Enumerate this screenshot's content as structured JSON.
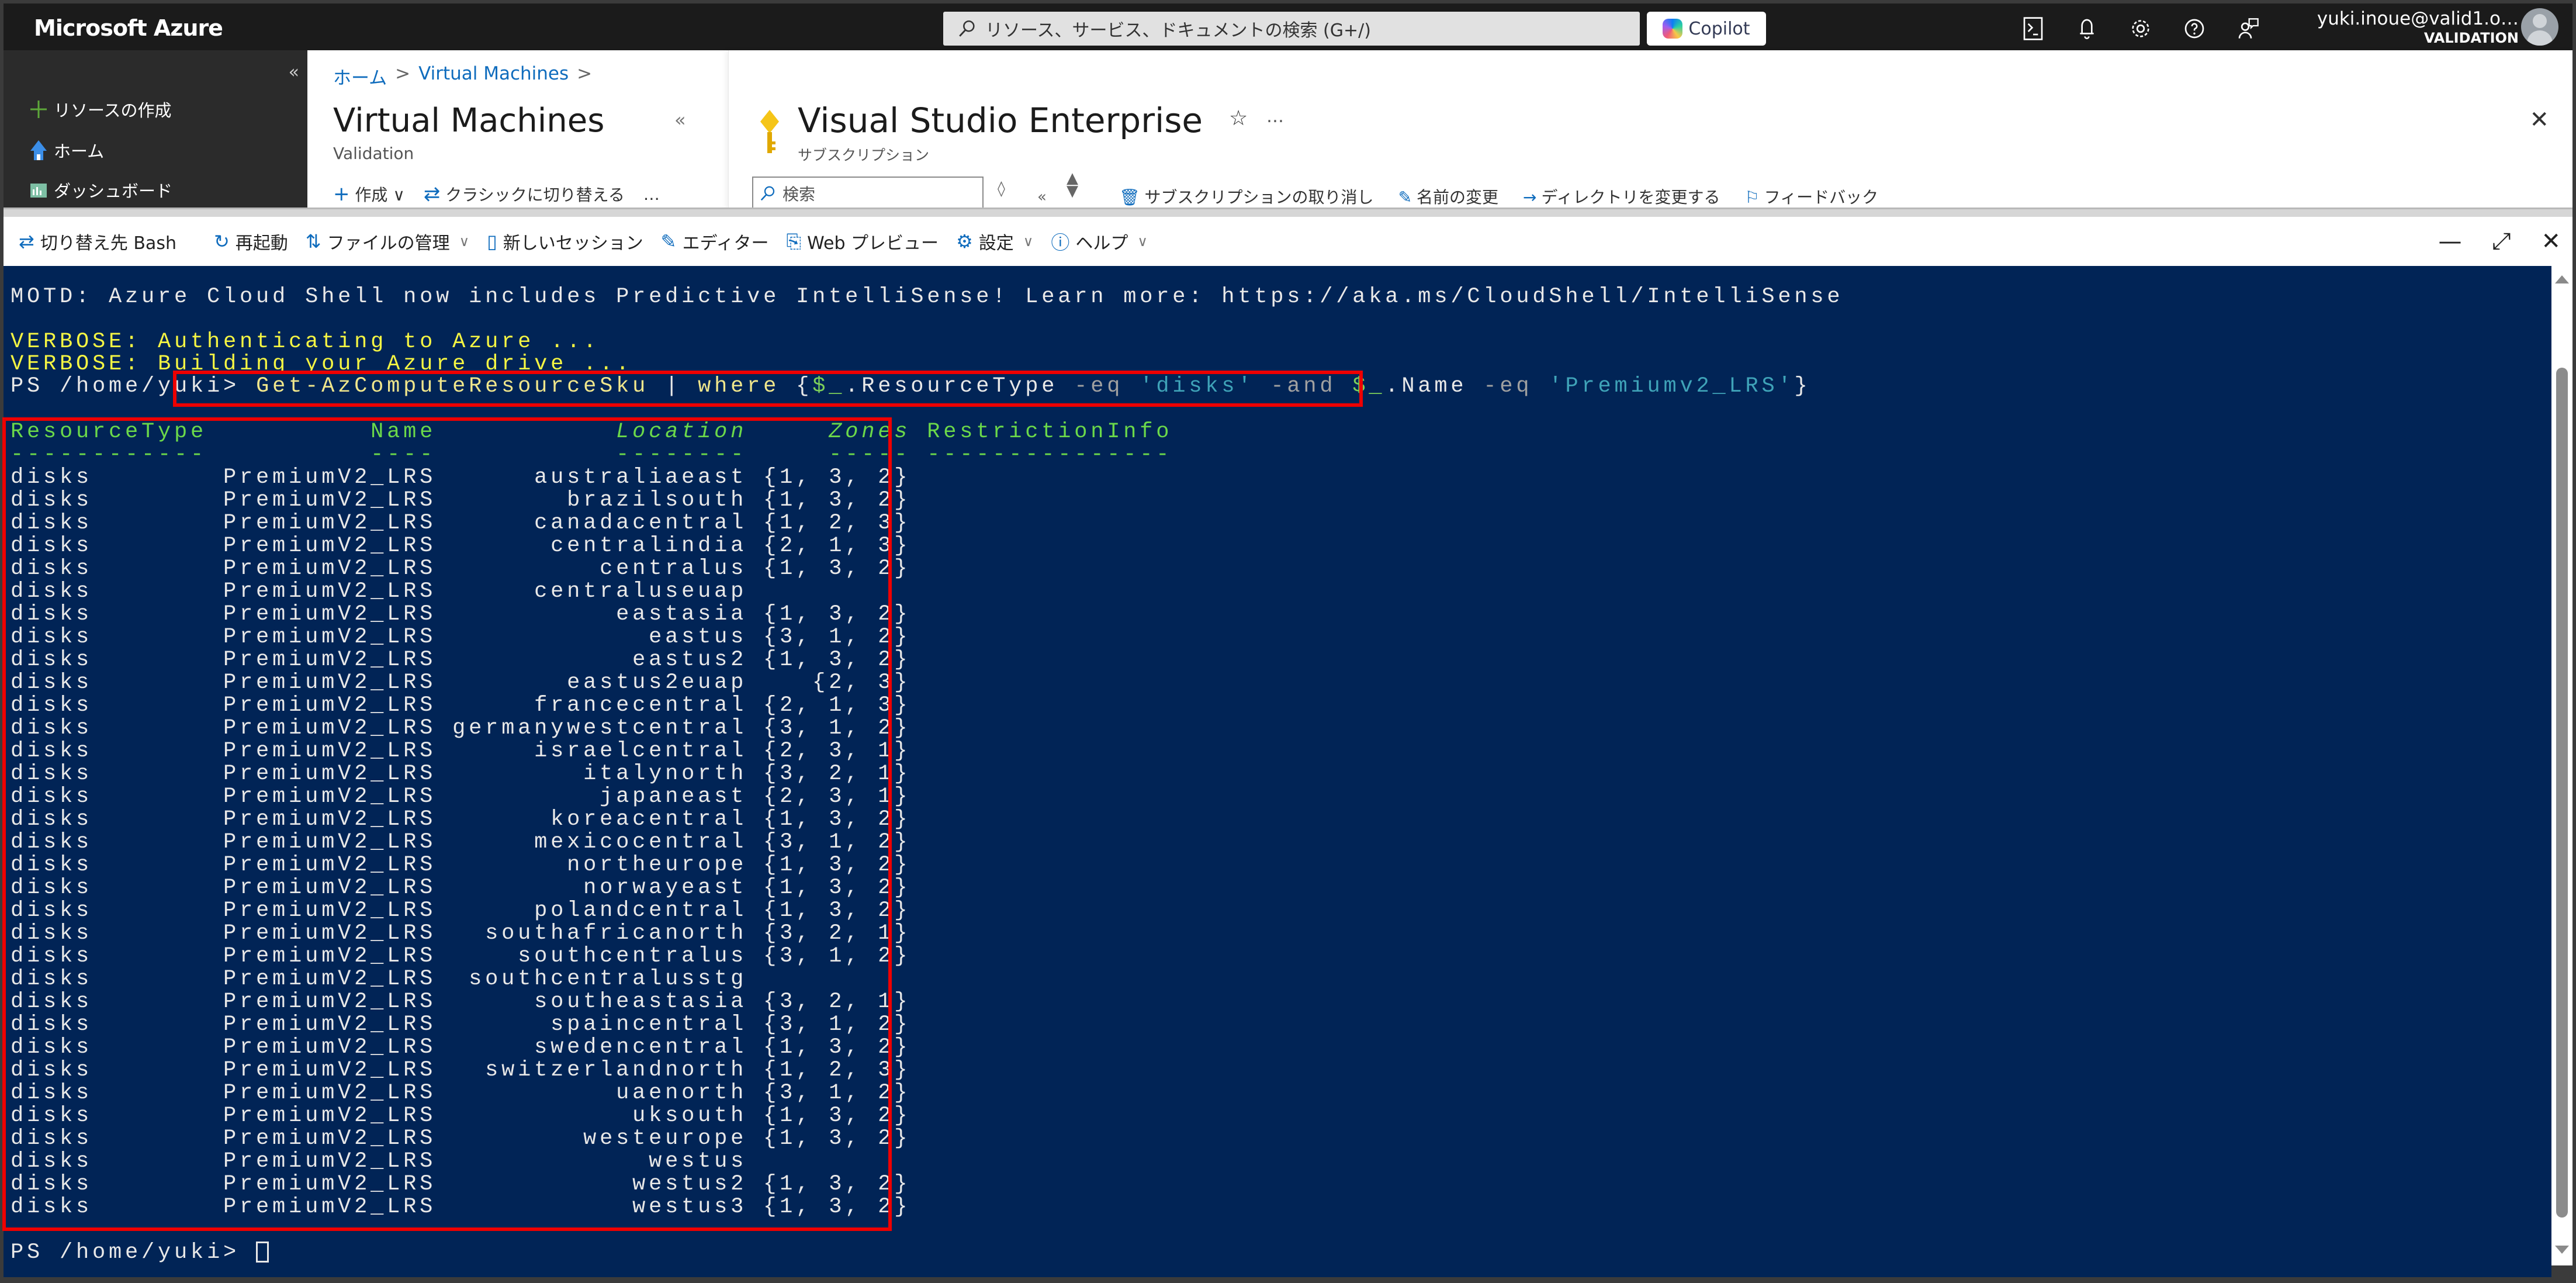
{
  "topbar": {
    "brand": "Microsoft Azure",
    "search_placeholder": "リソース、サービス、ドキュメントの検索 (G+/)",
    "copilot_label": "Copilot",
    "icons": [
      "cloud-shell-icon",
      "notifications-icon",
      "settings-icon",
      "help-icon",
      "feedback-icon"
    ],
    "account_email": "yuki.inoue@valid1.o…",
    "account_tenant": "VALIDATION"
  },
  "sidebar": {
    "collapse": "«",
    "items": [
      {
        "label": "リソースの作成",
        "icon": "plus-icon"
      },
      {
        "label": "ホーム",
        "icon": "home-icon"
      },
      {
        "label": "ダッシュボード",
        "icon": "dashboard-icon"
      }
    ]
  },
  "breadcrumb": [
    {
      "label": "ホーム"
    },
    {
      "label": "Virtual Machines"
    }
  ],
  "breadcrumb_sep": ">",
  "vm_blade": {
    "title": "Virtual Machines",
    "subtitle": "Validation",
    "collapse": "«",
    "commands": [
      {
        "label": "作成",
        "icon": "plus-icon",
        "dropdown": true
      },
      {
        "label": "クラシックに切り替える",
        "icon": "switch-icon"
      }
    ],
    "more": "…"
  },
  "sub_blade": {
    "title": "Visual Studio Enterprise",
    "subtitle": "サブスクリプション",
    "star": "☆",
    "more": "…",
    "close": "✕",
    "search_placeholder": "検索",
    "commands": [
      {
        "label": "サブスクリプションの取り消し",
        "icon": "delete-icon"
      },
      {
        "label": "名前の変更",
        "icon": "edit-icon"
      },
      {
        "label": "ディレクトリを変更する",
        "icon": "arrow-right-icon"
      },
      {
        "label": "フィードバック",
        "icon": "feedback-icon"
      }
    ]
  },
  "shell_toolbar": {
    "items": [
      {
        "label": "切り替え先 Bash",
        "icon": "switch-icon",
        "dropdown": false
      },
      {
        "label": "再起動",
        "icon": "restart-icon",
        "dropdown": false
      },
      {
        "label": "ファイルの管理",
        "icon": "upload-download-icon",
        "dropdown": true
      },
      {
        "label": "新しいセッション",
        "icon": "new-session-icon",
        "dropdown": false
      },
      {
        "label": "エディター",
        "icon": "editor-icon",
        "dropdown": false
      },
      {
        "label": "Web プレビュー",
        "icon": "web-preview-icon",
        "dropdown": false
      },
      {
        "label": "設定",
        "icon": "settings-icon",
        "dropdown": true
      },
      {
        "label": "ヘルプ",
        "icon": "help-icon",
        "dropdown": true
      }
    ],
    "window_controls": {
      "minimize": "—",
      "maximize": "⤢",
      "close": "✕"
    }
  },
  "terminal": {
    "motd": "MOTD: Azure Cloud Shell now includes Predictive IntelliSense! Learn more: https://aka.ms/CloudShell/IntelliSense",
    "verbose": [
      "VERBOSE: Authenticating to Azure ...",
      "VERBOSE: Building your Azure drive ..."
    ],
    "prompt": "PS /home/yuki> ",
    "command": {
      "cmdlet": "Get-AzComputeResourceSku",
      "pipe": " | ",
      "where": "where",
      "open": " {",
      "var1": "$_",
      "prop1": ".ResourceType ",
      "op1": "-eq ",
      "str1": "'disks'",
      "and": " -and ",
      "var2": "$_",
      "prop2": ".Name ",
      "op2": "-eq ",
      "str2": "'Premiumv2_LRS'",
      "close": "}"
    },
    "table": {
      "columns": [
        "ResourceType",
        "Name",
        "Location",
        "Zones",
        "RestrictionInfo"
      ],
      "header_line": "ResourceType          Name           Location     Zones RestrictionInfo",
      "underline": "------------          ----           --------     ----- ---------------",
      "rows": [
        {
          "ResourceType": "disks",
          "Name": "PremiumV2_LRS",
          "Location": "australiaeast",
          "Zones": "{1, 3, 2}"
        },
        {
          "ResourceType": "disks",
          "Name": "PremiumV2_LRS",
          "Location": "brazilsouth",
          "Zones": "{1, 3, 2}"
        },
        {
          "ResourceType": "disks",
          "Name": "PremiumV2_LRS",
          "Location": "canadacentral",
          "Zones": "{1, 2, 3}"
        },
        {
          "ResourceType": "disks",
          "Name": "PremiumV2_LRS",
          "Location": "centralindia",
          "Zones": "{2, 1, 3}"
        },
        {
          "ResourceType": "disks",
          "Name": "PremiumV2_LRS",
          "Location": "centralus",
          "Zones": "{1, 3, 2}"
        },
        {
          "ResourceType": "disks",
          "Name": "PremiumV2_LRS",
          "Location": "centraluseuap",
          "Zones": ""
        },
        {
          "ResourceType": "disks",
          "Name": "PremiumV2_LRS",
          "Location": "eastasia",
          "Zones": "{1, 3, 2}"
        },
        {
          "ResourceType": "disks",
          "Name": "PremiumV2_LRS",
          "Location": "eastus",
          "Zones": "{3, 1, 2}"
        },
        {
          "ResourceType": "disks",
          "Name": "PremiumV2_LRS",
          "Location": "eastus2",
          "Zones": "{1, 3, 2}"
        },
        {
          "ResourceType": "disks",
          "Name": "PremiumV2_LRS",
          "Location": "eastus2euap",
          "Zones": "{2, 3}"
        },
        {
          "ResourceType": "disks",
          "Name": "PremiumV2_LRS",
          "Location": "francecentral",
          "Zones": "{2, 1, 3}"
        },
        {
          "ResourceType": "disks",
          "Name": "PremiumV2_LRS",
          "Location": "germanywestcentral",
          "Zones": "{3, 1, 2}"
        },
        {
          "ResourceType": "disks",
          "Name": "PremiumV2_LRS",
          "Location": "israelcentral",
          "Zones": "{2, 3, 1}"
        },
        {
          "ResourceType": "disks",
          "Name": "PremiumV2_LRS",
          "Location": "italynorth",
          "Zones": "{3, 2, 1}"
        },
        {
          "ResourceType": "disks",
          "Name": "PremiumV2_LRS",
          "Location": "japaneast",
          "Zones": "{2, 3, 1}"
        },
        {
          "ResourceType": "disks",
          "Name": "PremiumV2_LRS",
          "Location": "koreacentral",
          "Zones": "{1, 3, 2}"
        },
        {
          "ResourceType": "disks",
          "Name": "PremiumV2_LRS",
          "Location": "mexicocentral",
          "Zones": "{3, 1, 2}"
        },
        {
          "ResourceType": "disks",
          "Name": "PremiumV2_LRS",
          "Location": "northeurope",
          "Zones": "{1, 3, 2}"
        },
        {
          "ResourceType": "disks",
          "Name": "PremiumV2_LRS",
          "Location": "norwayeast",
          "Zones": "{1, 3, 2}"
        },
        {
          "ResourceType": "disks",
          "Name": "PremiumV2_LRS",
          "Location": "polandcentral",
          "Zones": "{1, 3, 2}"
        },
        {
          "ResourceType": "disks",
          "Name": "PremiumV2_LRS",
          "Location": "southafricanorth",
          "Zones": "{3, 2, 1}"
        },
        {
          "ResourceType": "disks",
          "Name": "PremiumV2_LRS",
          "Location": "southcentralus",
          "Zones": "{3, 1, 2}"
        },
        {
          "ResourceType": "disks",
          "Name": "PremiumV2_LRS",
          "Location": "southcentralusstg",
          "Zones": ""
        },
        {
          "ResourceType": "disks",
          "Name": "PremiumV2_LRS",
          "Location": "southeastasia",
          "Zones": "{3, 2, 1}"
        },
        {
          "ResourceType": "disks",
          "Name": "PremiumV2_LRS",
          "Location": "spaincentral",
          "Zones": "{3, 1, 2}"
        },
        {
          "ResourceType": "disks",
          "Name": "PremiumV2_LRS",
          "Location": "swedencentral",
          "Zones": "{1, 3, 2}"
        },
        {
          "ResourceType": "disks",
          "Name": "PremiumV2_LRS",
          "Location": "switzerlandnorth",
          "Zones": "{1, 2, 3}"
        },
        {
          "ResourceType": "disks",
          "Name": "PremiumV2_LRS",
          "Location": "uaenorth",
          "Zones": "{3, 1, 2}"
        },
        {
          "ResourceType": "disks",
          "Name": "PremiumV2_LRS",
          "Location": "uksouth",
          "Zones": "{1, 3, 2}"
        },
        {
          "ResourceType": "disks",
          "Name": "PremiumV2_LRS",
          "Location": "westeurope",
          "Zones": "{1, 3, 2}"
        },
        {
          "ResourceType": "disks",
          "Name": "PremiumV2_LRS",
          "Location": "westus",
          "Zones": ""
        },
        {
          "ResourceType": "disks",
          "Name": "PremiumV2_LRS",
          "Location": "westus2",
          "Zones": "{1, 3, 2}"
        },
        {
          "ResourceType": "disks",
          "Name": "PremiumV2_LRS",
          "Location": "westus3",
          "Zones": "{1, 3, 2}"
        }
      ]
    },
    "final_prompt": "PS /home/yuki> "
  },
  "colors": {
    "terminal_bg": "#012456",
    "highlight_box": "#ee0000",
    "accent_blue": "#0f6cbd",
    "topbar_bg": "#1b1b1b"
  }
}
